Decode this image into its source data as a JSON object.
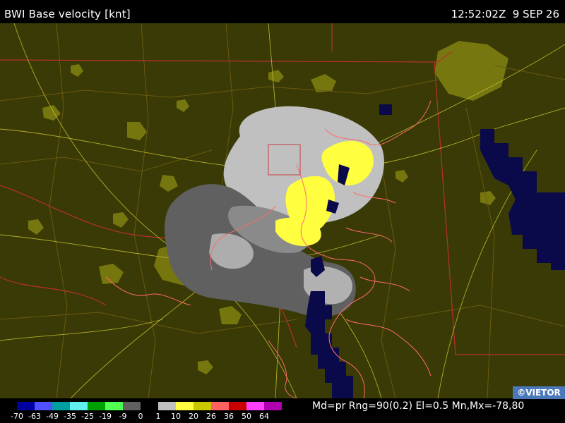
{
  "header": {
    "title": "BWI Base velocity [knt]",
    "datetime": "12:52:02Z  9 SEP 26"
  },
  "map": {
    "background_color": "#393a06",
    "state_line_color": "#b83030",
    "county_line_color": "#6a5a10",
    "road_color": "#c8c030",
    "coast_color": "#ff6a6a",
    "urban_color": "#7a7a10",
    "range_fold_color": "#0a0a4a"
  },
  "legend": {
    "colors": [
      "#0000a0",
      "#5050ff",
      "#00a0a0",
      "#60f0f0",
      "#00a000",
      "#50ff50",
      "#606060",
      "#000000",
      "#c0c0c0",
      "#ffff40",
      "#c8c800",
      "#ff6060",
      "#c80000",
      "#ff40ff",
      "#b000b0"
    ],
    "labels": [
      "-70",
      "-63",
      "-49",
      "-35",
      "-25",
      "-19",
      "-9",
      "0",
      "1",
      "10",
      "20",
      "26",
      "36",
      "50",
      "64"
    ]
  },
  "info_line": "Md=pr Rng=90(0.2) El=0.5 Mn,Mx=-78,80",
  "badge": "©VIETOR"
}
